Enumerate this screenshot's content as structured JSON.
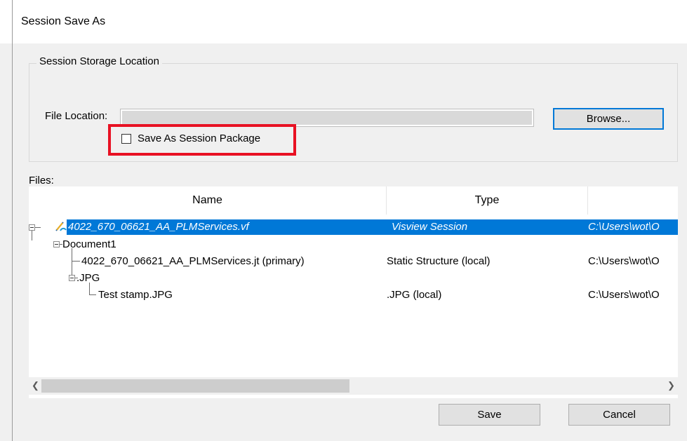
{
  "window": {
    "title": "Session Save As"
  },
  "storage": {
    "group_title": "Session Storage Location",
    "file_location_label": "File Location:",
    "file_location_value": "",
    "browse_label": "Browse...",
    "save_as_package_label": "Save As Session Package",
    "save_as_package_checked": false
  },
  "files": {
    "label": "Files:",
    "columns": [
      "Name",
      "Type"
    ],
    "rows": [
      {
        "name": "4022_670_06621_AA_PLMServices.vf",
        "type": "Visview Session",
        "path": "C:\\Users\\wot\\O"
      },
      {
        "name": "Document1",
        "type": "",
        "path": ""
      },
      {
        "name": "4022_670_06621_AA_PLMServices.jt (primary)",
        "type": "Static Structure (local)",
        "path": "C:\\Users\\wot\\O"
      },
      {
        "name": ".JPG",
        "type": "",
        "path": ""
      },
      {
        "name": "Test stamp.JPG",
        "type": ".JPG (local)",
        "path": "C:\\Users\\wot\\O"
      }
    ]
  },
  "buttons": {
    "save": "Save",
    "cancel": "Cancel"
  },
  "colors": {
    "selection": "#0078d7",
    "highlight_box": "#e81123",
    "default_button_border": "#0078d7"
  }
}
